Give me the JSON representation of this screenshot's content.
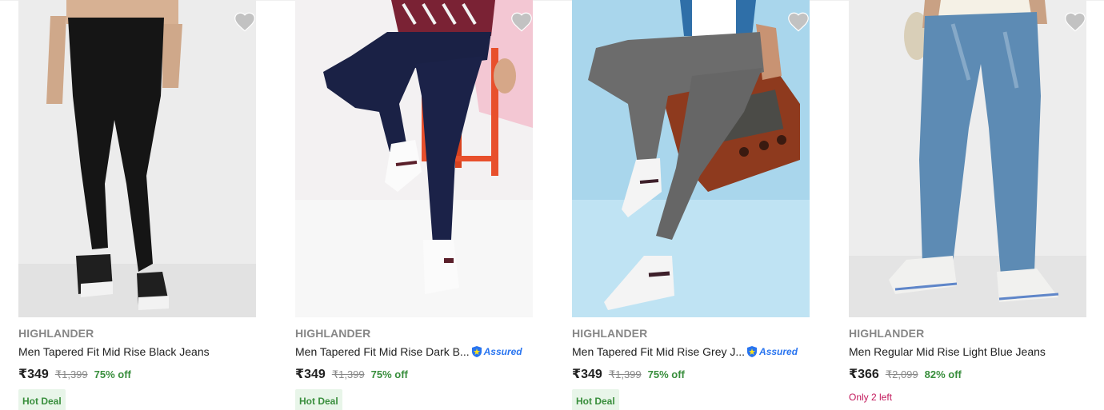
{
  "products": [
    {
      "brand": "HIGHLANDER",
      "title": "Men Tapered Fit Mid Rise Black Jeans",
      "price": "₹349",
      "mrp": "₹1,399",
      "discount": "75% off",
      "tag": "Hot Deal",
      "stock": "",
      "assured": false,
      "image_alt": "black jeans"
    },
    {
      "brand": "HIGHLANDER",
      "title": "Men Tapered Fit Mid Rise Dark B...",
      "price": "₹349",
      "mrp": "₹1,399",
      "discount": "75% off",
      "tag": "Hot Deal",
      "stock": "",
      "assured": true,
      "image_alt": "dark blue jeans"
    },
    {
      "brand": "HIGHLANDER",
      "title": "Men Tapered Fit Mid Rise Grey J...",
      "price": "₹349",
      "mrp": "₹1,399",
      "discount": "75% off",
      "tag": "Hot Deal",
      "stock": "",
      "assured": true,
      "image_alt": "grey jeans"
    },
    {
      "brand": "HIGHLANDER",
      "title": "Men Regular Mid Rise Light Blue Jeans",
      "price": "₹366",
      "mrp": "₹2,099",
      "discount": "82% off",
      "tag": "",
      "stock": "Only 2 left",
      "assured": false,
      "image_alt": "light blue jeans"
    }
  ],
  "assured_label": "Assured",
  "icons": {
    "wishlist": "heart-icon",
    "assured": "shield-icon"
  },
  "colors": {
    "discount": "#388e3c",
    "hot_deal_bg": "#e8f5e9",
    "stock": "#c2185b",
    "assured": "#2874f0",
    "brand": "#878787"
  }
}
